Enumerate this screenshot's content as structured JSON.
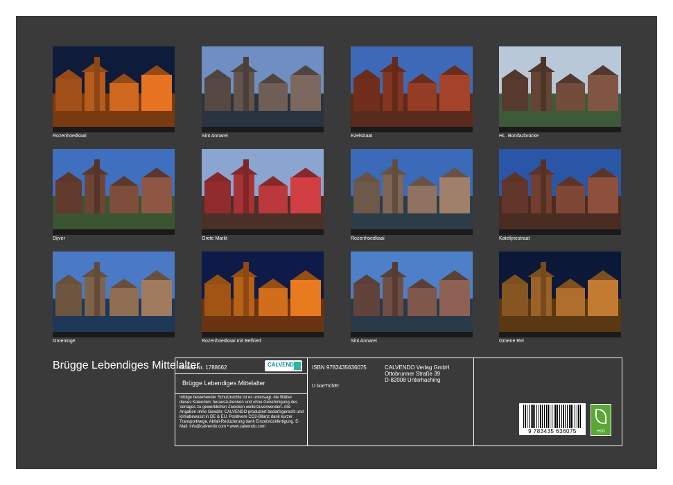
{
  "photos": [
    {
      "caption": "Rozenhoedkaai",
      "colors": {
        "sky": "#0e1b3a",
        "bldg": "#c8641e",
        "ground": "#7a3a10"
      }
    },
    {
      "caption": "Sint Annarei",
      "colors": {
        "sky": "#6f8fc2",
        "bldg": "#6b5a52",
        "ground": "#2a3440"
      }
    },
    {
      "caption": "Ezelstraat",
      "colors": {
        "sky": "#3e69b8",
        "bldg": "#8e3a24",
        "ground": "#5a2a1c"
      }
    },
    {
      "caption": "HL. Bonifazbrücke",
      "colors": {
        "sky": "#b9c8d8",
        "bldg": "#6e4a3a",
        "ground": "#3d5a3a"
      }
    },
    {
      "caption": "Dijver",
      "colors": {
        "sky": "#3f70c0",
        "bldg": "#7a4a3a",
        "ground": "#3a5530"
      }
    },
    {
      "caption": "Grote Markt",
      "colors": {
        "sky": "#8aa6d0",
        "bldg": "#b4363a",
        "ground": "#4a3028"
      }
    },
    {
      "caption": "Rozenhoedkaai",
      "colors": {
        "sky": "#3a6ab8",
        "bldg": "#8a6e5c",
        "ground": "#2c3c48"
      }
    },
    {
      "caption": "Katelijnestraat",
      "colors": {
        "sky": "#2a56a8",
        "bldg": "#7a4434",
        "ground": "#4a2c22"
      }
    },
    {
      "caption": "Groeninge",
      "colors": {
        "sky": "#4a7ac6",
        "bldg": "#8a6a50",
        "ground": "#1e3858"
      }
    },
    {
      "caption": "Rozenhoedkaai mit Belfried",
      "colors": {
        "sky": "#0e1a48",
        "bldg": "#c86a1a",
        "ground": "#6a3410"
      }
    },
    {
      "caption": "Sint Annarei",
      "colors": {
        "sky": "#4d80c8",
        "bldg": "#7a5448",
        "ground": "#2a3a4a"
      }
    },
    {
      "caption": "Groene Rei",
      "colors": {
        "sky": "#0c1838",
        "bldg": "#a86a2a",
        "ground": "#5a3814"
      }
    }
  ],
  "title": "Brügge Lebendiges Mittelalter",
  "info": {
    "artikel": "Artikel-Nr. 1788662",
    "calvendo_logo": "CALVENDO",
    "subtitle": "Brügge Lebendiges Mittelalter",
    "notice": "Infolge bestehender Schutzrechte ist es untersagt, die Blätter dieses Kalenders herauszutrennen und ohne Genehmigung des Verlages zu gewerblichen Zwecken weiterzuverwenden. Alle Angaben ohne Gewähr. CALVENDO produziert bedarfsgerecht und klimabewusst in DE & EU. Positivere CO2-Bilanz dank kurzer Transportwege. Abfall-Reduzierung dank Einzelstückfertigung. E-Mail: info@calvendo.com • www.calvendo.com",
    "isbn": "ISBN 9783435636075",
    "author": "U boeTIchEr",
    "publisher": [
      "CALVENDO Verlag GmbH",
      "Ottobrunner Straße 39",
      "D-82008 Unterhaching"
    ],
    "barcode_number": "9 783435 636075",
    "eco_label": "eco"
  },
  "colors": {
    "sheet": "#3a3a3a",
    "eco_green": "#5aa832"
  }
}
